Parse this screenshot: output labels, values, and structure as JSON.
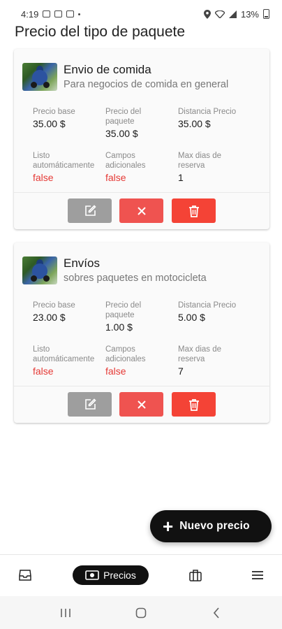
{
  "status_bar": {
    "time": "4:19",
    "battery": "13%"
  },
  "page_title": "Precio del tipo de paquete",
  "labels": {
    "base_price": "Precio base",
    "package_price": "Precio del paquete",
    "distance_price": "Distancia Precio",
    "auto_ready": "Listo automáticamente",
    "extra_fields": "Campos adicionales",
    "max_days": "Max dias de reserva"
  },
  "cards": [
    {
      "name": "Envio de comida",
      "description": "Para negocios de comida en general",
      "base_price": "35.00 $",
      "package_price": "35.00 $",
      "distance_price": "35.00 $",
      "auto_ready": "false",
      "extra_fields": "false",
      "max_days": "1"
    },
    {
      "name": "Envíos",
      "description": "sobres paquetes en motocicleta",
      "base_price": "23.00 $",
      "package_price": "1.00 $",
      "distance_price": "5.00 $",
      "auto_ready": "false",
      "extra_fields": "false",
      "max_days": "7"
    }
  ],
  "fab": {
    "icon": "plus-icon",
    "label": "Nuevo precio"
  },
  "bottom_nav": {
    "items": [
      {
        "icon": "inbox-icon"
      },
      {
        "icon": "banknote-icon",
        "label": "Precios",
        "active": true
      },
      {
        "icon": "briefcase-icon"
      },
      {
        "icon": "menu-icon"
      }
    ]
  },
  "colors": {
    "accent": "#111111",
    "danger": "#f44336",
    "edit": "#9e9e9e",
    "false_text": "#e53935"
  }
}
